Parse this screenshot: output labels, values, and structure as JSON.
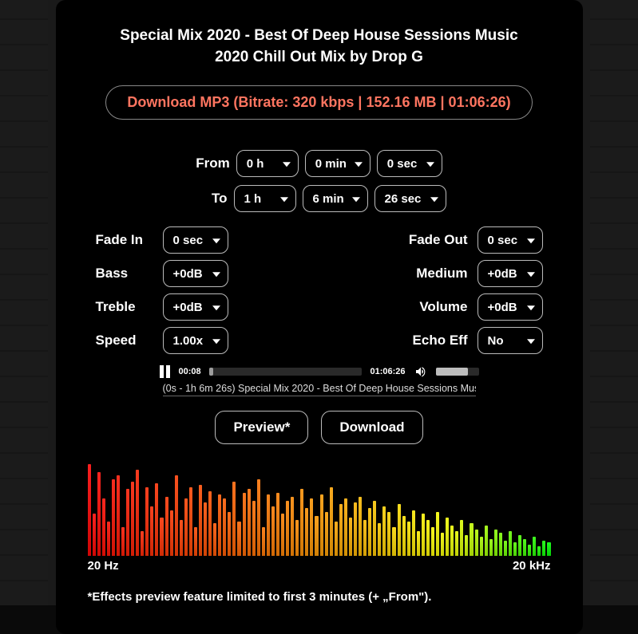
{
  "title": "Special Mix 2020 - Best Of Deep House Sessions Music 2020 Chill Out Mix by Drop G",
  "download_label": "Download MP3 (Bitrate: 320 kbps | 152.16 MB | 01:06:26)",
  "range": {
    "from_label": "From",
    "to_label": "To",
    "from": {
      "h": "0 h",
      "m": "0 min",
      "s": "0 sec"
    },
    "to": {
      "h": "1 h",
      "m": "6 min",
      "s": "26 sec"
    }
  },
  "controls": {
    "fade_in": {
      "label": "Fade In",
      "value": "0 sec"
    },
    "fade_out": {
      "label": "Fade Out",
      "value": "0 sec"
    },
    "bass": {
      "label": "Bass",
      "value": "+0dB"
    },
    "medium": {
      "label": "Medium",
      "value": "+0dB"
    },
    "treble": {
      "label": "Treble",
      "value": "+0dB"
    },
    "volume": {
      "label": "Volume",
      "value": "+0dB"
    },
    "speed": {
      "label": "Speed",
      "value": "1.00x"
    },
    "echo": {
      "label": "Echo Eff",
      "value": "No"
    }
  },
  "player": {
    "current": "00:08",
    "total": "01:06:26",
    "now_playing": "(0s - 1h 6m 26s) Special Mix 2020 - Best Of Deep House Sessions Mus"
  },
  "buttons": {
    "preview": "Preview*",
    "download": "Download"
  },
  "axis": {
    "low": "20 Hz",
    "high": "20 kHz"
  },
  "footnote": "*Effects preview feature limited to first 3 minutes (+ „From\").",
  "spectrum": [
    96,
    44,
    88,
    60,
    36,
    80,
    84,
    30,
    70,
    78,
    90,
    26,
    72,
    52,
    76,
    40,
    62,
    48,
    84,
    38,
    60,
    72,
    30,
    74,
    56,
    68,
    34,
    64,
    60,
    46,
    78,
    36,
    66,
    70,
    58,
    80,
    30,
    64,
    52,
    66,
    44,
    58,
    62,
    38,
    70,
    50,
    60,
    42,
    64,
    46,
    72,
    36,
    54,
    60,
    40,
    56,
    62,
    38,
    50,
    58,
    34,
    52,
    46,
    30,
    54,
    42,
    36,
    48,
    26,
    44,
    38,
    30,
    46,
    24,
    40,
    32,
    26,
    38,
    22,
    34,
    28,
    20,
    32,
    18,
    28,
    24,
    16,
    26,
    14,
    22,
    18,
    12,
    20,
    10,
    16,
    14
  ]
}
